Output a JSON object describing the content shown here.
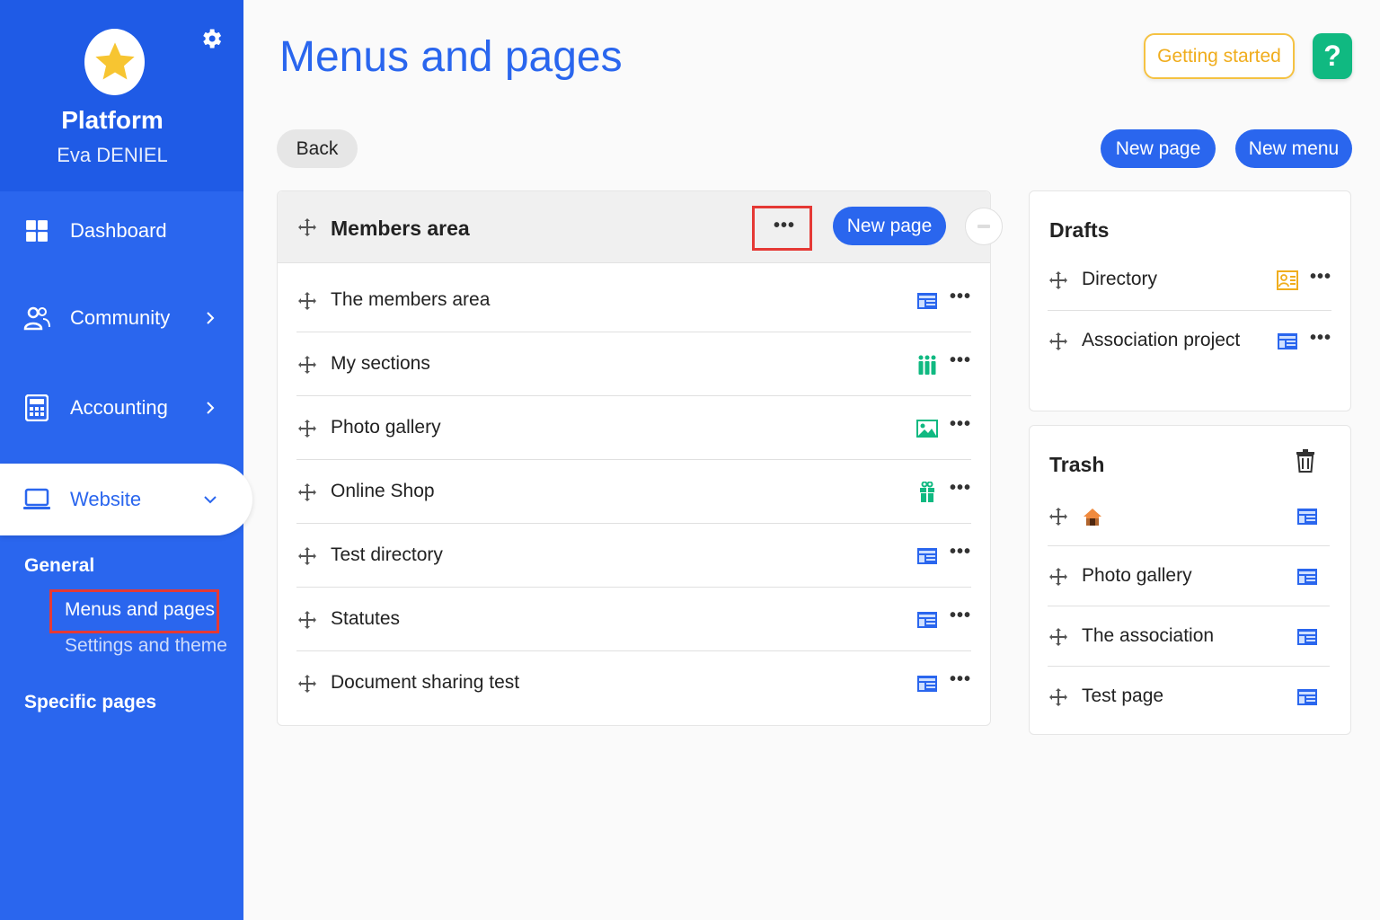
{
  "sidebar": {
    "platform_name": "Platform",
    "user_name": "Eva DENIEL",
    "nav": {
      "dashboard": "Dashboard",
      "community": "Community",
      "accounting": "Accounting",
      "website": "Website"
    },
    "sections": {
      "general": "General",
      "menus_pages": "Menus and pages",
      "settings_theme": "Settings and theme",
      "specific_pages": "Specific pages"
    }
  },
  "header": {
    "title": "Menus and pages",
    "getting_started": "Getting started",
    "help": "?"
  },
  "toolbar": {
    "back": "Back",
    "new_page": "New page",
    "new_menu": "New menu"
  },
  "members_area": {
    "title": "Members area",
    "more": "•••",
    "new_page": "New page",
    "items": [
      {
        "label": "The members area",
        "icon": "page-layout-icon"
      },
      {
        "label": "My sections",
        "icon": "people-icon"
      },
      {
        "label": "Photo gallery",
        "icon": "image-icon"
      },
      {
        "label": "Online Shop",
        "icon": "gift-icon"
      },
      {
        "label": "Test directory",
        "icon": "page-layout-icon"
      },
      {
        "label": "Statutes",
        "icon": "page-layout-icon"
      },
      {
        "label": "Document sharing test",
        "icon": "page-layout-icon"
      }
    ]
  },
  "drafts": {
    "title": "Drafts",
    "items": [
      {
        "label": "Directory",
        "icon": "contact-card-icon"
      },
      {
        "label": "Association project",
        "icon": "page-layout-icon"
      }
    ]
  },
  "trash": {
    "title": "Trash",
    "items": [
      {
        "label": "",
        "icon": "home-icon"
      },
      {
        "label": "Photo gallery",
        "icon": "page-layout-icon"
      },
      {
        "label": "The association",
        "icon": "page-layout-icon"
      },
      {
        "label": "Test page",
        "icon": "page-layout-icon"
      }
    ]
  },
  "colors": {
    "primary": "#2a66ee",
    "accent_yellow": "#f0ad1d",
    "help_green": "#10b981",
    "highlight_red": "#e53935"
  }
}
